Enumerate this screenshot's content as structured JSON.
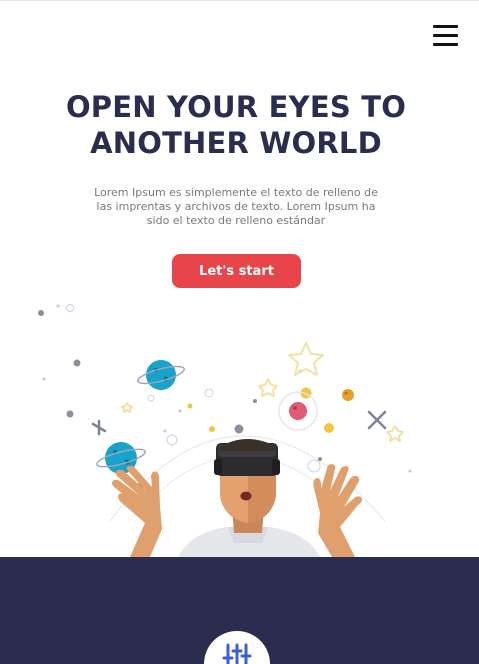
{
  "nav": {
    "menu_icon": "hamburger-menu-icon"
  },
  "hero": {
    "title_line1": "OPEN YOUR EYES TO",
    "title_line2": "ANOTHER WORLD",
    "description": "Lorem Ipsum es simplemente el texto de relleno de las imprentas y archivos de texto. Lorem Ipsum ha sido el texto de relleno estándar",
    "cta_label": "Let's start"
  },
  "illustration": {
    "icon": "vr-headset-person-space-illustration"
  },
  "feature": {
    "icon": "sliders-icon"
  },
  "colors": {
    "title": "#2a2d4e",
    "accent": "#e8454a",
    "footer_bg": "#2b2d4e",
    "planet_blue": "#1aa3c9"
  }
}
